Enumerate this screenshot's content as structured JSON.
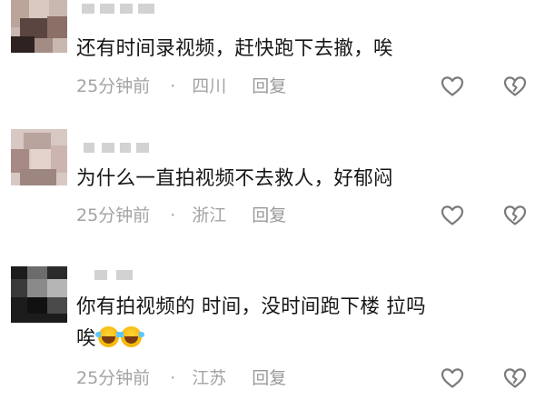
{
  "comments": [
    {
      "text": "还有时间录视频，赶快跑下去撤，唉",
      "time": "25分钟前",
      "separator": "·",
      "location": "四川",
      "reply_label": "回复"
    },
    {
      "text": "为什么一直拍视频不去救人，好郁闷",
      "time": "25分钟前",
      "separator": "·",
      "location": "浙江",
      "reply_label": "回复"
    },
    {
      "text_line1": "你有拍视频的 时间，没时间跑下楼 拉吗",
      "text_line2": "唉",
      "emoji_names": [
        "rolling-on-floor-laughing-emoji",
        "rolling-on-floor-laughing-emoji"
      ],
      "time": "25分钟前",
      "separator": "·",
      "location": "江苏",
      "reply_label": "回复"
    }
  ],
  "icons": {
    "like": "heart-outline-icon",
    "dislike": "broken-heart-outline-icon"
  },
  "colors": {
    "text": "#161616",
    "meta": "#a3a3a3",
    "icon": "#7a7a7a",
    "emoji": "#f5b400"
  }
}
